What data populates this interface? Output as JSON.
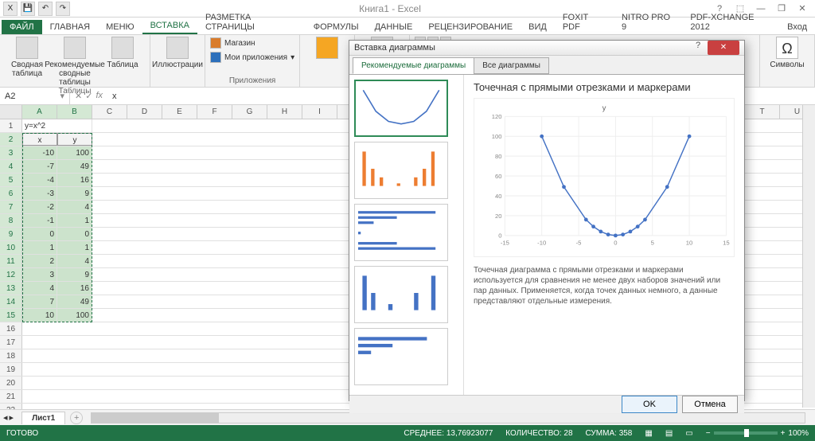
{
  "app": {
    "title": "Книга1 - Excel"
  },
  "qat": {
    "save": "💾",
    "undo": "↶",
    "redo": "↷"
  },
  "tabs": {
    "file": "ФАЙЛ",
    "home": "ГЛАВНАЯ",
    "menu": "Меню",
    "insert": "ВСТАВКА",
    "layout": "РАЗМЕТКА СТРАНИЦЫ",
    "formulas": "ФОРМУЛЫ",
    "data": "ДАННЫЕ",
    "review": "РЕЦЕНЗИРОВАНИЕ",
    "view": "ВИД",
    "foxit": "Foxit PDF",
    "nitro": "NITRO PRO 9",
    "pdfx": "PDF-XChange 2012",
    "signin": "Вход"
  },
  "ribbon": {
    "pivot": "Сводная таблица",
    "rec_pivot": "Рекомендуемые сводные таблицы",
    "table": "Таблица",
    "tables_label": "Таблицы",
    "illustrations": "Иллюстрации",
    "store": "Магазин",
    "myapps": "Мои приложения",
    "apps_label": "Приложения",
    "bing": "",
    "rec_charts": "Рекомендуемые диаграммы",
    "symbols": "Символы"
  },
  "formula": {
    "name": "A2",
    "fx": "fx",
    "value": "x"
  },
  "columns": [
    "A",
    "B",
    "C",
    "D",
    "E",
    "F",
    "G",
    "H",
    "I",
    "T",
    "U"
  ],
  "sheet": {
    "formula_label": "y=x^2",
    "rows": [
      {
        "x": "x",
        "y": "y"
      },
      {
        "x": "-10",
        "y": "100"
      },
      {
        "x": "-7",
        "y": "49"
      },
      {
        "x": "-4",
        "y": "16"
      },
      {
        "x": "-3",
        "y": "9"
      },
      {
        "x": "-2",
        "y": "4"
      },
      {
        "x": "-1",
        "y": "1"
      },
      {
        "x": "0",
        "y": "0"
      },
      {
        "x": "1",
        "y": "1"
      },
      {
        "x": "2",
        "y": "4"
      },
      {
        "x": "3",
        "y": "9"
      },
      {
        "x": "4",
        "y": "16"
      },
      {
        "x": "7",
        "y": "49"
      },
      {
        "x": "10",
        "y": "100"
      }
    ]
  },
  "sheet_tab": "Лист1",
  "dialog": {
    "title": "Вставка диаграммы",
    "tab1": "Рекомендуемые диаграммы",
    "tab2": "Все диаграммы",
    "chart_title": "Точечная с прямыми отрезками и маркерами",
    "series_label": "y",
    "desc": "Точечная диаграмма с прямыми отрезками и маркерами используется для сравнения не менее двух наборов значений или пар данных. Применяется, когда точек данных немного, а данные представляют отдельные измерения.",
    "ok": "OK",
    "cancel": "Отмена"
  },
  "status": {
    "ready": "ГОТОВО",
    "avg_label": "СРЕДНЕЕ:",
    "avg": "13,76923077",
    "cnt_label": "КОЛИЧЕСТВО:",
    "cnt": "28",
    "sum_label": "СУММА:",
    "sum": "358",
    "zoom": "100%"
  },
  "chart_data": {
    "type": "line",
    "title": "y",
    "x": [
      -10,
      -7,
      -4,
      -3,
      -2,
      -1,
      0,
      1,
      2,
      3,
      4,
      7,
      10
    ],
    "values": [
      100,
      49,
      16,
      9,
      4,
      1,
      0,
      1,
      4,
      9,
      16,
      49,
      100
    ],
    "xlim": [
      -15,
      15
    ],
    "ylim": [
      0,
      120
    ],
    "xticks": [
      -15,
      -10,
      -5,
      0,
      5,
      10,
      15
    ],
    "yticks": [
      0,
      20,
      40,
      60,
      80,
      100,
      120
    ]
  }
}
